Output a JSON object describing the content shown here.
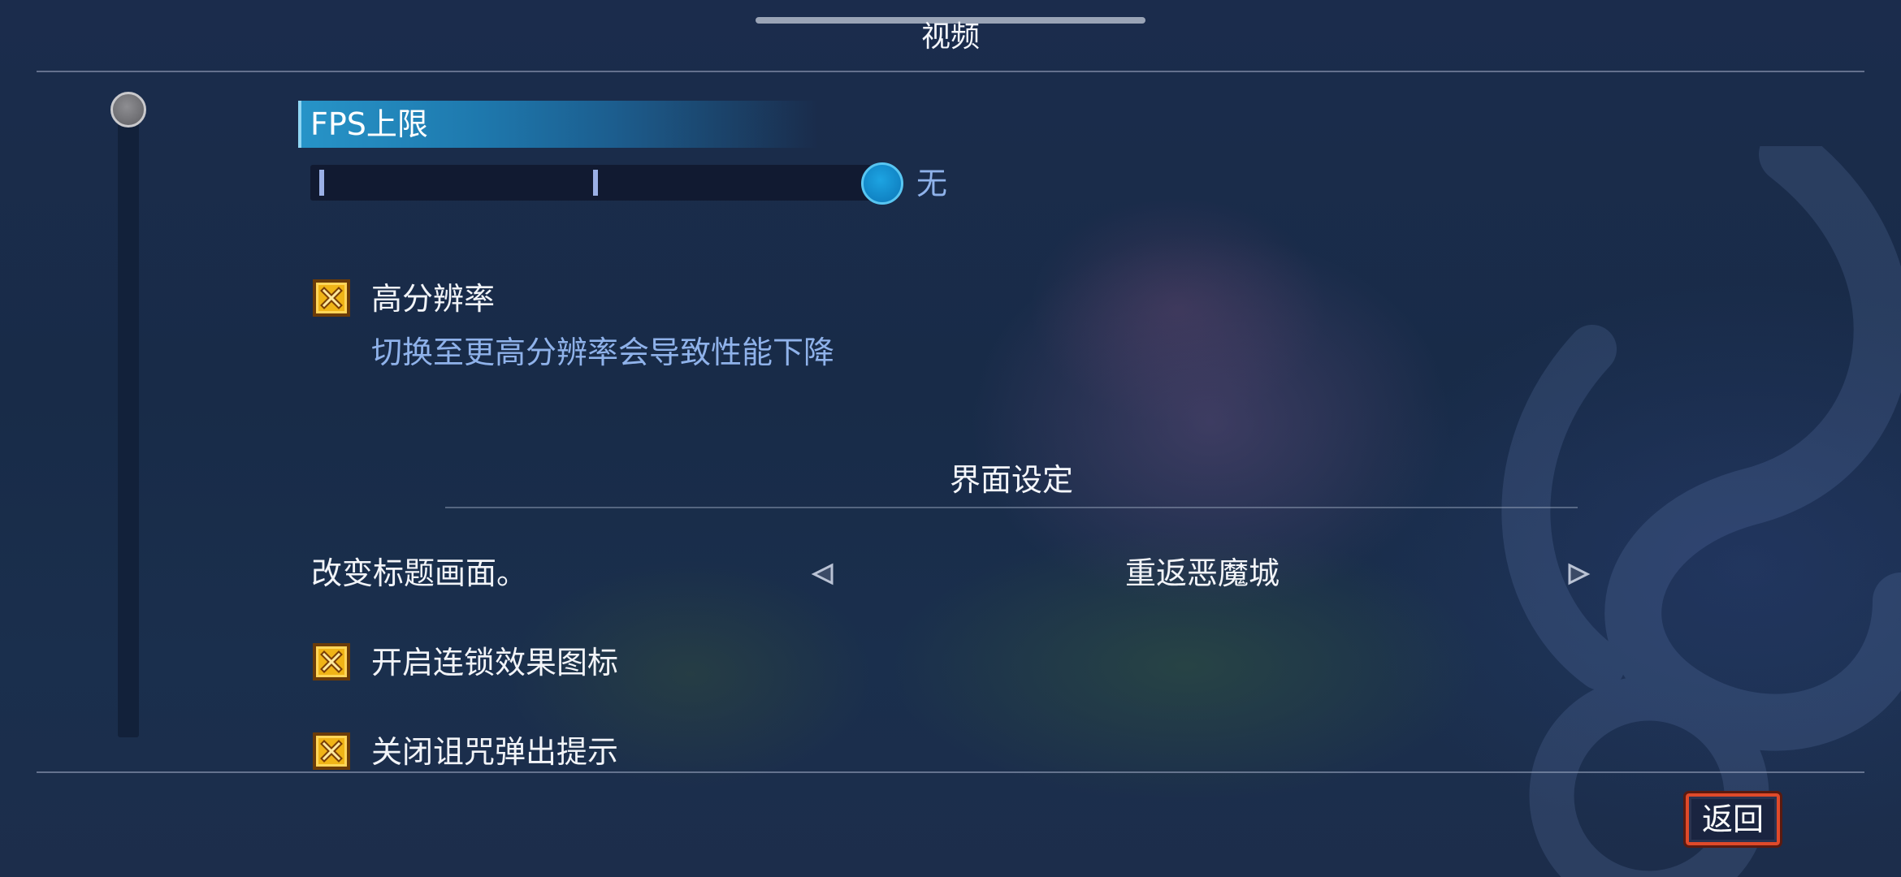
{
  "header": {
    "title": "视频"
  },
  "fps_limit": {
    "label": "FPS上限",
    "value_text": "无",
    "level": 1.0
  },
  "high_resolution": {
    "label": "高分辨率",
    "checked": true,
    "note": "切换至更高分辨率会导致性能下降"
  },
  "interface_section": {
    "title": "界面设定"
  },
  "title_screen": {
    "label": "改变标题画面。",
    "value": "重返恶魔城",
    "prev_icon": "triangle-left-icon",
    "next_icon": "triangle-right-icon"
  },
  "synergy_icons": {
    "label": "开启连锁效果图标",
    "checked": true
  },
  "curse_popup": {
    "label": "关闭诅咒弹出提示",
    "checked": true
  },
  "footer": {
    "back_label": "返回"
  },
  "colors": {
    "accent": "#1e88c8",
    "checkbox": "#f0b417",
    "note_text": "#8fb2ea",
    "back_border": "#e04a2a"
  }
}
